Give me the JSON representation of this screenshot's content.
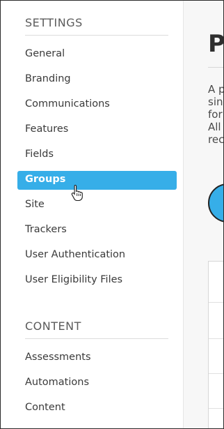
{
  "sidebar": {
    "settings_title": "SETTINGS",
    "settings_items": [
      {
        "label": "General"
      },
      {
        "label": "Branding"
      },
      {
        "label": "Communications"
      },
      {
        "label": "Features"
      },
      {
        "label": "Fields"
      },
      {
        "label": "Groups",
        "active": true
      },
      {
        "label": "Site"
      },
      {
        "label": "Trackers"
      },
      {
        "label": "User Authentication"
      },
      {
        "label": "User Eligibility Files"
      }
    ],
    "content_title": "CONTENT",
    "content_items": [
      {
        "label": "Assessments"
      },
      {
        "label": "Automations"
      },
      {
        "label": "Content"
      }
    ]
  },
  "main": {
    "title": "P",
    "description": "A p\nsin\nfor\nAll\nrec"
  },
  "colors": {
    "accent": "#36aee8",
    "text": "#3a3a3a",
    "section": "#5b5b5b"
  },
  "icons": {
    "cursor": "hand-pointer-icon"
  }
}
